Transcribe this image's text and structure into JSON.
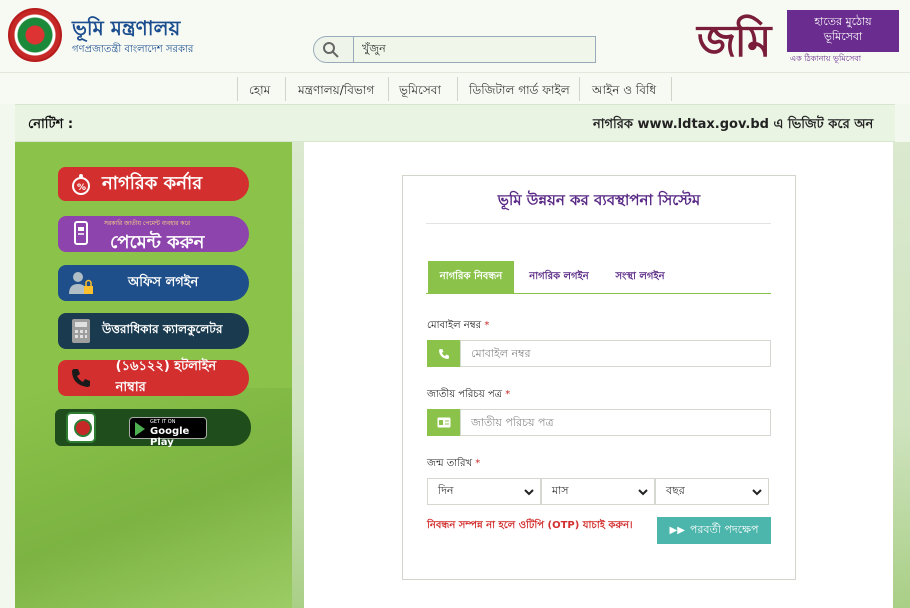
{
  "header": {
    "brand_title": "ভূমি মন্ত্রণালয়",
    "brand_subtitle": "গণপ্রজাতন্ত্রী বাংলাদেশ সরকার",
    "search": {
      "value": "খুঁজুন"
    },
    "jomi_logo_text": "জমি",
    "jomi_badge_line1": "হাতের মুঠোয়",
    "jomi_badge_line2": "ভূমিসেবা",
    "jomi_tagline": "এক ঠিকানায় ভূমিসেবা"
  },
  "nav": {
    "items": [
      "হোম",
      "মন্ত্রণালয়/বিভাগ",
      "ভূমিসেবা",
      "ডিজিটাল গার্ড ফাইল",
      "আইন ও বিধি"
    ]
  },
  "notice": {
    "label": "নোটিশ :",
    "text": "নাগরিক www.ldtax.gov.bd এ ভিজিট করে অন"
  },
  "sidebar": {
    "citizen_corner": "নাগরিক কর্নার",
    "payment_small": "সরকারি জাতীয় পেমেন্ট ব্যবহার করে",
    "payment_big": "পেমেন্ট করুন",
    "office_login": "অফিস লগইন",
    "calculator": "উত্তরাধিকার ক্যালকুলেটর",
    "hotline": "(১৬১২২) হটলাইন নাম্বার",
    "google_play_top": "GET IT ON",
    "google_play": "Google Play"
  },
  "form": {
    "title": "ভূমি উন্নয়ন কর ব্যবস্থাপনা সিস্টেম",
    "tabs": [
      "নাগরিক নিবন্ধন",
      "নাগরিক লগইন",
      "সংস্থা লগইন"
    ],
    "mobile_label": "মোবাইল নম্বর",
    "mobile_placeholder": "মোবাইল নম্বর",
    "nid_label": "জাতীয় পরিচয় পত্র",
    "nid_placeholder": "জাতীয় পরিচয় পত্র",
    "dob_label": "জন্ম তারিখ",
    "required_mark": "*",
    "day": "দিন",
    "month": "মাস",
    "year": "বছর",
    "otp_note": "নিবন্ধন সম্পন্ন না হলে ওটিপি (OTP) যাচাই করুন।",
    "next_button": "পরবর্তী পদক্ষেপ"
  },
  "colors": {
    "green": "#8bc34a",
    "purple": "#5a2a86",
    "red": "#d32f2f",
    "teal": "#4db6ac"
  }
}
